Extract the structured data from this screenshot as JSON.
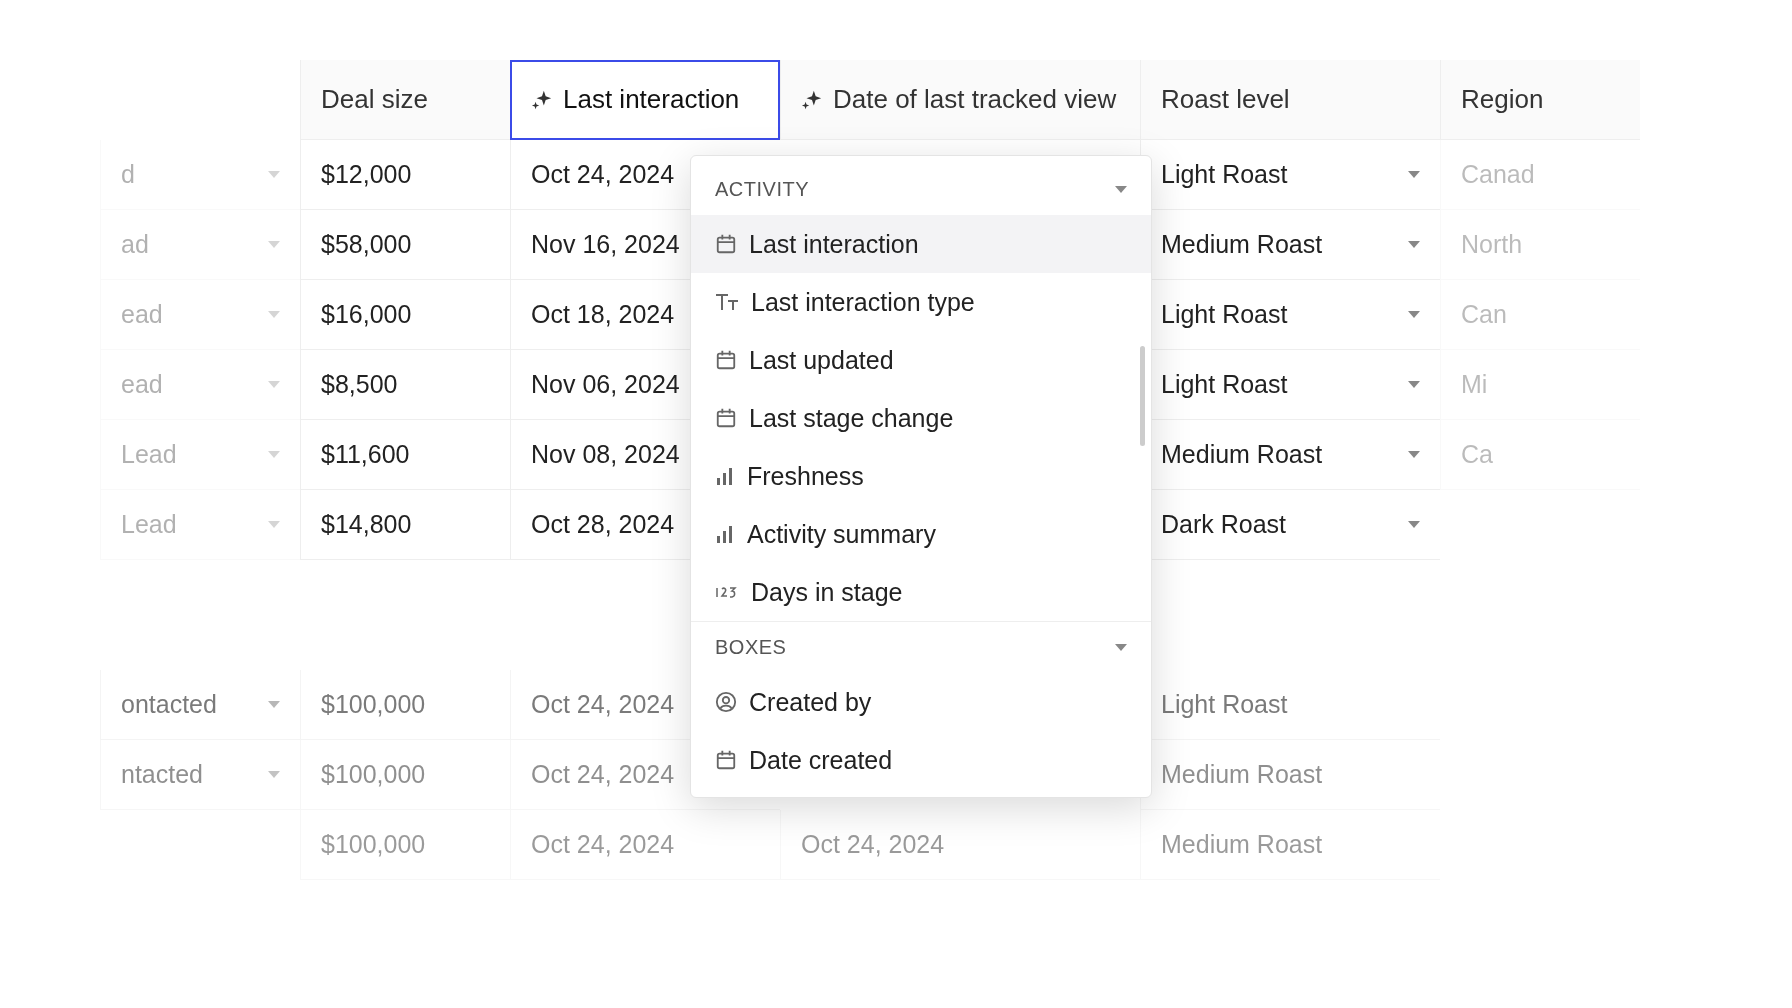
{
  "table": {
    "columns": [
      {
        "label": "Deal size",
        "ai": false,
        "selected": false
      },
      {
        "label": "Last interaction",
        "ai": true,
        "selected": true
      },
      {
        "label": "Date of last tracked view",
        "ai": true,
        "selected": false
      },
      {
        "label": "Roast level",
        "ai": false,
        "selected": false
      },
      {
        "label": "Region",
        "ai": false,
        "selected": false
      }
    ],
    "rows": [
      {
        "status": "d",
        "deal": "$12,000",
        "last": "Oct 24, 2024",
        "roast": "Light Roast",
        "region": "Canad"
      },
      {
        "status": "ad",
        "deal": "$58,000",
        "last": "Nov 16, 2024",
        "roast": "Medium Roast",
        "region": "North"
      },
      {
        "status": "ead",
        "deal": "$16,000",
        "last": "Oct 18, 2024",
        "roast": "Light Roast",
        "region": "Can"
      },
      {
        "status": "ead",
        "deal": "$8,500",
        "last": "Nov 06, 2024",
        "roast": "Light Roast",
        "region": "Mi"
      },
      {
        "status": "Lead",
        "deal": "$11,600",
        "last": "Nov 08, 2024",
        "roast": "Medium Roast",
        "region": "Ca"
      },
      {
        "status": "Lead",
        "deal": "$14,800",
        "last": "Oct 28, 2024",
        "roast": "Dark Roast"
      }
    ],
    "more_rows": [
      {
        "status": "ontacted",
        "deal": "$100,000",
        "last": "Oct 24, 2024",
        "roast": "Light Roast"
      },
      {
        "status": "ntacted",
        "deal": "$100,000",
        "last": "Oct 24, 2024",
        "roast": "Medium Roast"
      },
      {
        "deal": "$100,000",
        "last": "Oct 24, 2024",
        "tracked": "Oct 24, 2024",
        "roast": "Medium Roast"
      }
    ]
  },
  "menu": {
    "sections": [
      {
        "title": "ACTIVITY",
        "items": [
          {
            "label": "Last interaction",
            "kind": "date",
            "selected": true
          },
          {
            "label": "Last interaction type",
            "kind": "text",
            "selected": false
          },
          {
            "label": "Last updated",
            "kind": "date",
            "selected": false
          },
          {
            "label": "Last stage change",
            "kind": "date",
            "selected": false
          },
          {
            "label": "Freshness",
            "kind": "bars",
            "selected": false
          },
          {
            "label": "Activity summary",
            "kind": "bars",
            "selected": false
          },
          {
            "label": "Days in stage",
            "kind": "number",
            "selected": false
          }
        ]
      },
      {
        "title": "BOXES",
        "items": [
          {
            "label": "Created by",
            "kind": "user",
            "selected": false
          },
          {
            "label": "Date created",
            "kind": "date",
            "selected": false
          }
        ]
      }
    ]
  }
}
